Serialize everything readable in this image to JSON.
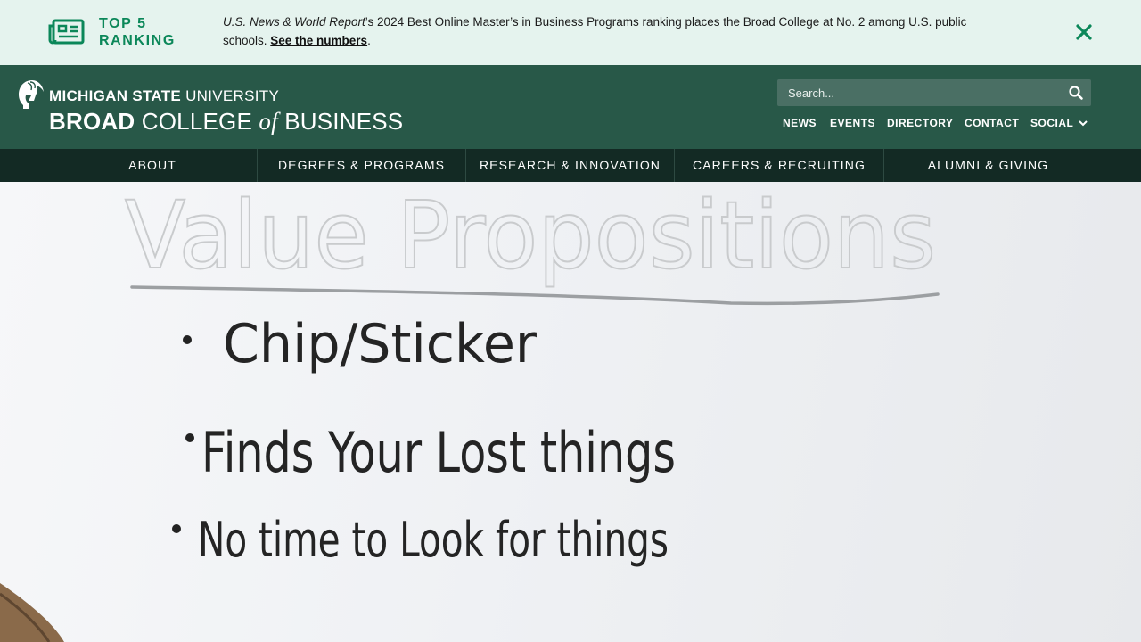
{
  "alert": {
    "heading_line1": "TOP 5",
    "heading_line2": "RANKING",
    "publication": "U.S. News & World Report",
    "text_main": "’s 2024 Best Online Master’s in Business Programs ranking places the Broad College at No. 2 among U.S. public schools. ",
    "link_text": "See the numbers",
    "text_end": ".",
    "icon": "newspaper-icon",
    "close_icon": "close-icon",
    "accent_color": "#0b8759"
  },
  "header": {
    "logo_msu_bold": "MICHIGAN STATE",
    "logo_msu_rest": " UNIVERSITY",
    "logo_broad_bold": "BROAD",
    "logo_college": " COLLEGE ",
    "logo_of": "of",
    "logo_business": " BUSINESS",
    "search_placeholder": "Search...",
    "utility_links": [
      "NEWS",
      "EVENTS",
      "DIRECTORY",
      "CONTACT",
      "SOCIAL"
    ],
    "background_color": "#285848"
  },
  "main_nav": {
    "items": [
      "ABOUT",
      "DEGREES & PROGRAMS",
      "RESEARCH & INNOVATION",
      "CAREERS & RECRUITING",
      "ALUMNI & GIVING"
    ],
    "background_color": "#132a24"
  },
  "hero": {
    "whiteboard_title": "Value Propositions",
    "whiteboard_items": [
      "Chip/Sticker",
      "Finds Your Lost things",
      "No time to Look for things"
    ]
  }
}
